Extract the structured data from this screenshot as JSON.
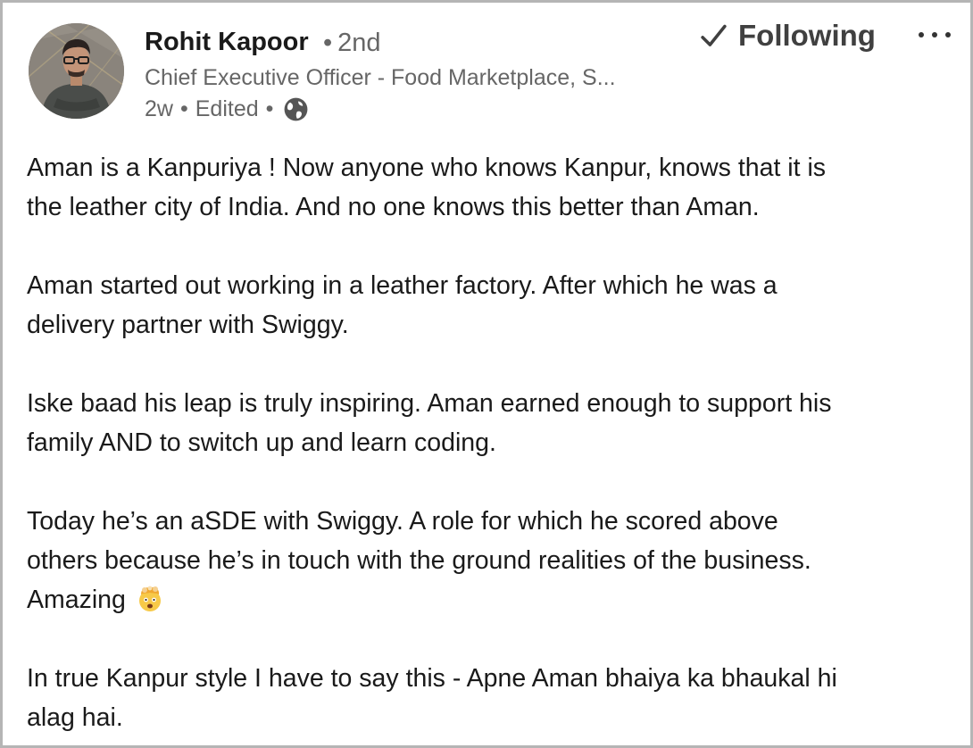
{
  "post": {
    "author": {
      "name": "Rohit Kapoor",
      "degree_separator": "•",
      "degree": "2nd",
      "headline": "Chief Executive Officer - Food Marketplace, S...",
      "time": "2w",
      "edited": "Edited",
      "visibility_icon": "globe-icon"
    },
    "follow_button_label": "Following",
    "follow_icon": "check-icon",
    "more_icon": "more-horizontal-icon",
    "paragraphs": [
      {
        "lines": [
          "Aman is a Kanpuriya ! Now anyone who knows Kanpur, knows that it is",
          "the leather city of India. And no one knows this better than Aman."
        ]
      },
      {
        "lines": [
          "Aman started out working in a leather factory. After which he was a",
          "delivery partner with Swiggy."
        ]
      },
      {
        "lines": [
          "Iske baad his leap is truly inspiring. Aman earned enough to support his",
          "family AND to switch up and learn coding."
        ]
      },
      {
        "lines": [
          "Today he’s an aSDE with Swiggy. A role for which he scored above",
          "others because he’s in touch with the ground realities of the business.",
          "Amazing"
        ],
        "trailing_emoji": "exploding-head-emoji"
      },
      {
        "lines": [
          "In true Kanpur style I have to say this - Apne Aman bhaiya ka bhaukal hi",
          "alag hai."
        ]
      }
    ]
  },
  "colors": {
    "name": "#1a1a1a",
    "secondary_text": "#666666",
    "body_text": "#1a1a1a",
    "border": "#b5b5b5"
  }
}
